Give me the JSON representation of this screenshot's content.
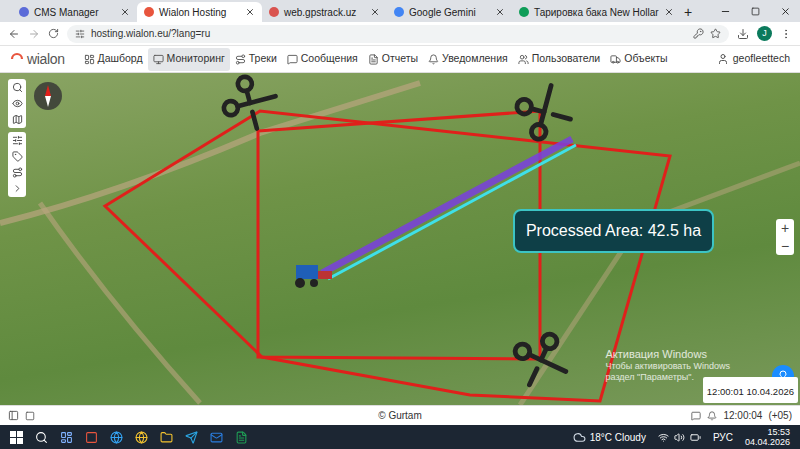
{
  "browser": {
    "tabs": [
      {
        "label": "CMS Manager",
        "selected": false,
        "color": "#5b6bd8"
      },
      {
        "label": "Wialon Hosting",
        "selected": true,
        "color": "#e8553e"
      },
      {
        "label": "web.gpstrack.uz",
        "selected": false,
        "color": "#d9534f"
      },
      {
        "label": "Google Gemini",
        "selected": false,
        "color": "#4285f4"
      },
      {
        "label": "Тарировка бака New Hollar",
        "selected": false,
        "color": "#0f9d58"
      }
    ],
    "new_tab": "+",
    "url": "hosting.wialon.eu/?lang=ru",
    "profile": "J"
  },
  "app": {
    "logo": "wialon",
    "nav": [
      {
        "label": "Дашборд",
        "selected": false
      },
      {
        "label": "Мониторинг",
        "selected": true
      },
      {
        "label": "Треки",
        "selected": false
      },
      {
        "label": "Сообщения",
        "selected": false
      },
      {
        "label": "Отчеты",
        "selected": false
      },
      {
        "label": "Уведомления",
        "selected": false
      },
      {
        "label": "Пользователи",
        "selected": false
      },
      {
        "label": "Объекты",
        "selected": false
      }
    ],
    "user": "geofleettech"
  },
  "map": {
    "label": "Processed Area: 42.5 ha",
    "zoom_in": "+",
    "zoom_out": "−",
    "time_label": "12:00:01 10.04.2026",
    "watermark": [
      "Активация Windows",
      "Чтобы активировать Windows",
      "раздел \"Параметры\"."
    ]
  },
  "footer": {
    "copyright": "© Gurtam",
    "time": "12:00:04",
    "timezone": "(+05)"
  },
  "taskbar": {
    "weather": "18°C Cloudy",
    "language": "РУС",
    "time": "15:53",
    "date": "04.04.2026"
  }
}
